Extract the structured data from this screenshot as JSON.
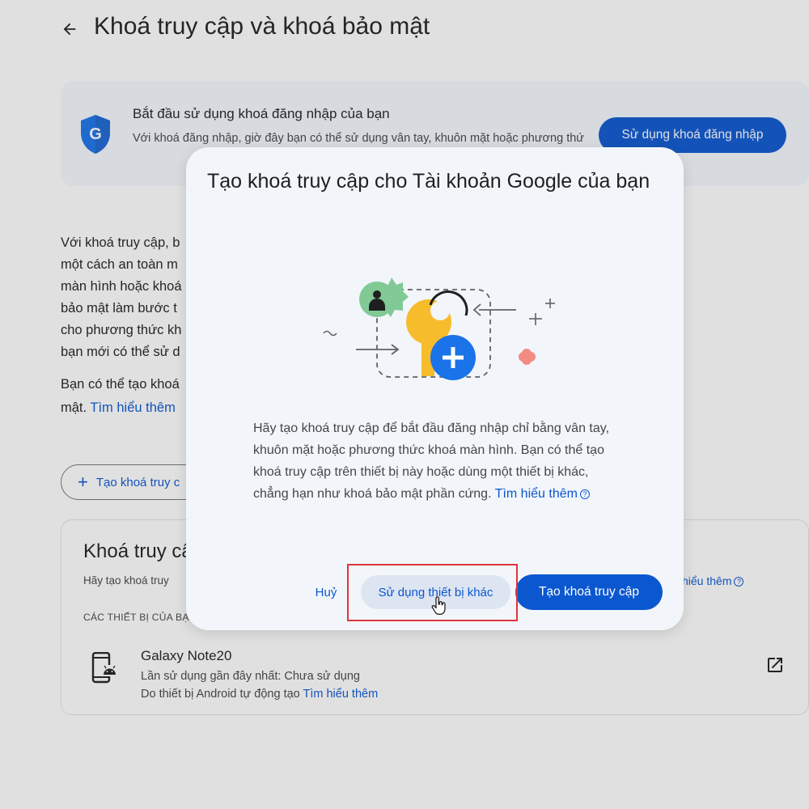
{
  "page": {
    "title": "Khoá truy cập và khoá bảo mật",
    "promo": {
      "title": "Bắt đầu sử dụng khoá đăng nhập của bạn",
      "text": "Với khoá đăng nhập, giờ đây bạn có thể sử dụng vân tay, khuôn mặt hoặc phương thứ",
      "button": "Sử dụng khoá đăng nhập"
    },
    "intro_lines": [
      "Với khoá truy cập, b",
      "một cách an toàn m",
      "màn hình hoặc khoá",
      "bảo mật làm bước t",
      "cho phương thức kh",
      "bạn mới có thể sử d"
    ],
    "intro2_line1": "Bạn có thể tạo khoá",
    "intro2_prefix": "mật. ",
    "intro2_link": "Tìm hiểu thêm",
    "create_button": "Tạo khoá truy c",
    "passkeys": {
      "title": "Khoá truy cập",
      "subtitle": "Hãy tạo khoá truy",
      "learn_more": "hiểu thêm",
      "devices_label": "CÁC THIẾT BỊ CỦA BẠN",
      "device": {
        "name": "Galaxy Note20",
        "last_used": "Lần sử dụng gần đây nhất: Chưa sử dụng",
        "created_prefix": "Do thiết bị Android tự động tạo ",
        "created_link": "Tìm hiểu thêm"
      }
    }
  },
  "dialog": {
    "title": "Tạo khoá truy cập cho Tài khoản Google của bạn",
    "body": "Hãy tạo khoá truy cập để bắt đầu đăng nhập chỉ bằng vân tay, khuôn mặt hoặc phương thức khoá màn hình. Bạn có thể tạo khoá truy cập trên thiết bị này hoặc dùng một thiết bị khác, chẳng hạn như khoá bảo mật phần cứng. ",
    "learn_more": "Tìm hiểu thêm",
    "cancel": "Huỷ",
    "use_other_device": "Sử dụng thiết bị khác",
    "create_passkey": "Tạo khoá truy cập"
  },
  "colors": {
    "accent": "#0b57d0",
    "highlight": "#e0343b",
    "dialog_bg": "#f2f6fb"
  },
  "icons": [
    "back-arrow-icon",
    "shield-g-icon",
    "plus-icon",
    "help-icon",
    "android-phone-icon",
    "open-external-icon",
    "cursor-hand-icon"
  ]
}
